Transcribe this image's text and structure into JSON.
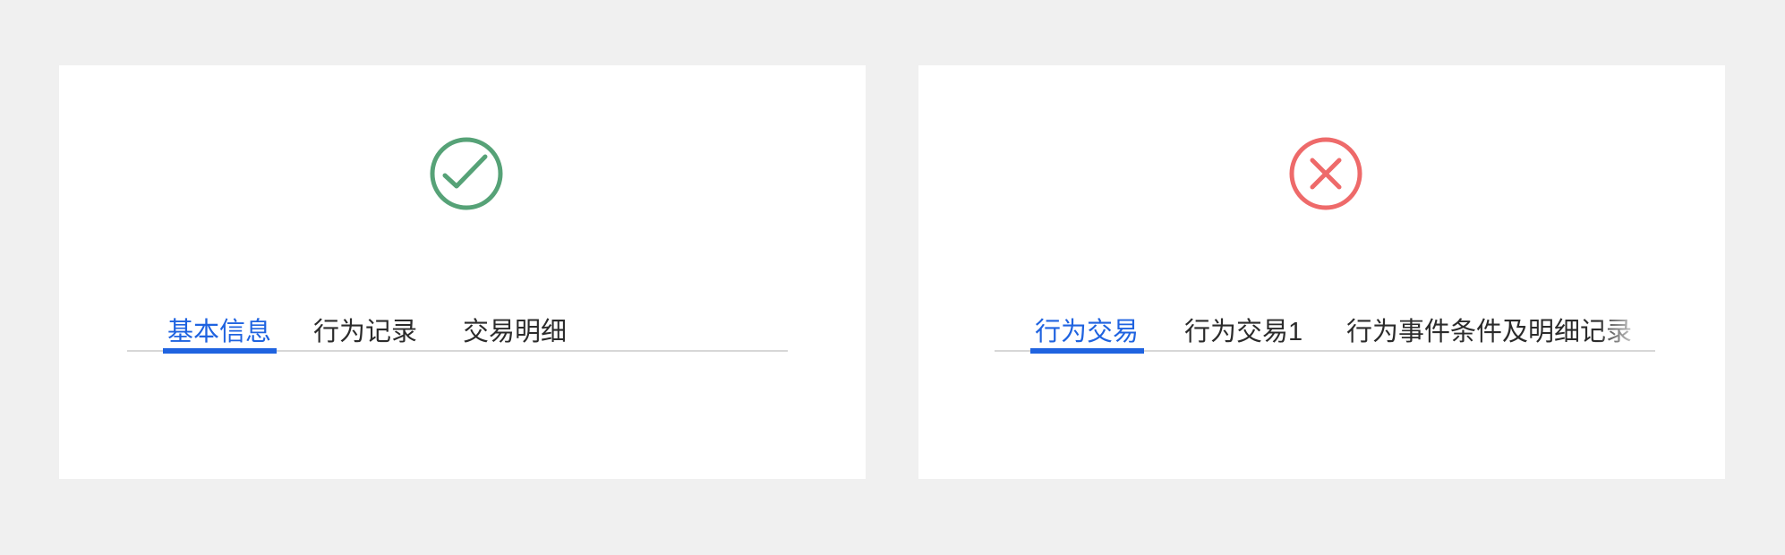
{
  "colors": {
    "background": "#f0f0f0",
    "panel": "#ffffff",
    "success": "#56a277",
    "error": "#ee6a6a",
    "active_tab": "#1f63e0",
    "inactive_tab": "#2b2b2b"
  },
  "panels": [
    {
      "status_icon": "check-circle-icon",
      "tabs": [
        {
          "label": "基本信息",
          "active": true
        },
        {
          "label": "行为记录",
          "active": false
        },
        {
          "label": "交易明细",
          "active": false
        }
      ]
    },
    {
      "status_icon": "close-circle-icon",
      "tabs": [
        {
          "label": "行为交易",
          "active": true
        },
        {
          "label": "行为交易1",
          "active": false
        },
        {
          "label": "行为事件条件及明细记录",
          "active": false
        }
      ]
    }
  ]
}
